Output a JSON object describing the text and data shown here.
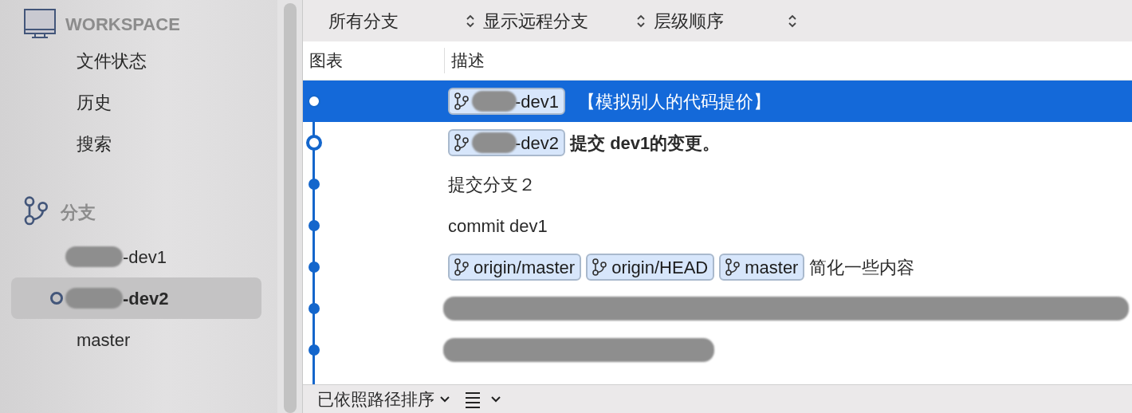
{
  "sidebar": {
    "workspace": {
      "title": "WORKSPACE",
      "items": [
        {
          "label": "文件状态"
        },
        {
          "label": "历史"
        },
        {
          "label": "搜索"
        }
      ]
    },
    "branches": {
      "title": "分支",
      "items": [
        {
          "label": "-dev1",
          "redacted": true,
          "current": false,
          "selected": false
        },
        {
          "label": "-dev2",
          "redacted": true,
          "current": true,
          "selected": true
        },
        {
          "label": "master",
          "redacted": false,
          "current": false,
          "selected": false
        }
      ]
    }
  },
  "toolbar": {
    "filters": [
      {
        "label": "所有分支"
      },
      {
        "label": "显示远程分支"
      },
      {
        "label": "层级顺序"
      }
    ]
  },
  "table": {
    "columns": [
      "图表",
      "描述"
    ],
    "rows": [
      {
        "kind": "open",
        "selected": true,
        "bold": false,
        "tags": [
          {
            "label": "-dev1",
            "redacted": true
          }
        ],
        "description": "【模拟别人的代码提价】"
      },
      {
        "kind": "current",
        "selected": false,
        "bold": true,
        "tags": [
          {
            "label": "-dev2",
            "redacted": true
          }
        ],
        "description": "提交 dev1的变更。"
      },
      {
        "kind": "dot",
        "selected": false,
        "bold": false,
        "tags": [],
        "description": "提交分支２"
      },
      {
        "kind": "dot",
        "selected": false,
        "bold": false,
        "tags": [],
        "description": "commit dev1"
      },
      {
        "kind": "dot",
        "selected": false,
        "bold": false,
        "tags": [
          {
            "label": "origin/master",
            "redacted": false
          },
          {
            "label": "origin/HEAD",
            "redacted": false
          },
          {
            "label": "master",
            "redacted": false
          }
        ],
        "description": "简化一些内容"
      },
      {
        "kind": "dot",
        "selected": false,
        "bold": false,
        "tags": []
      },
      {
        "kind": "dot",
        "selected": false,
        "bold": false,
        "tags": []
      }
    ]
  },
  "status_bar": {
    "sort": "已依照路径排序"
  }
}
